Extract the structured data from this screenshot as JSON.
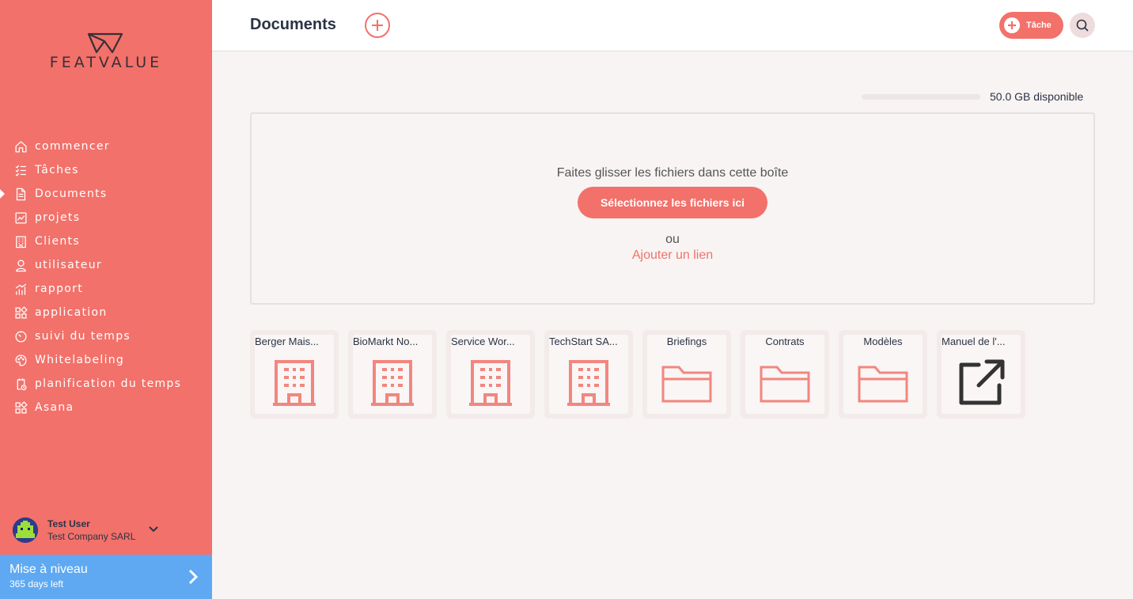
{
  "brand": {
    "logo_text": "FEATVALUE"
  },
  "sidebar": {
    "items": [
      {
        "label": "commencer",
        "icon": "home-icon"
      },
      {
        "label": "Tâches",
        "icon": "checklist-icon"
      },
      {
        "label": "Documents",
        "icon": "document-icon",
        "active": true
      },
      {
        "label": "projets",
        "icon": "chart-icon"
      },
      {
        "label": "Clients",
        "icon": "building-icon"
      },
      {
        "label": "utilisateur",
        "icon": "user-icon"
      },
      {
        "label": "rapport",
        "icon": "report-icon"
      },
      {
        "label": "application",
        "icon": "apps-icon"
      },
      {
        "label": "suivi du temps",
        "icon": "timer-icon"
      },
      {
        "label": "Whitelabeling",
        "icon": "palette-icon"
      },
      {
        "label": "planification du temps",
        "icon": "schedule-icon"
      },
      {
        "label": "Asana",
        "icon": "apps-icon"
      }
    ]
  },
  "user": {
    "name": "Test User",
    "company": "Test Company SARL"
  },
  "upgrade": {
    "title": "Mise à niveau",
    "subtitle": "365 days left"
  },
  "header": {
    "title": "Documents",
    "task_label": "Tâche"
  },
  "storage": {
    "text": "50.0 GB disponible",
    "used_fraction": 0
  },
  "dropzone": {
    "instruction": "Faites glisser les fichiers dans cette boîte",
    "select_label": "Sélectionnez les fichiers ici",
    "or_label": "ou",
    "link_label": "Ajouter un lien"
  },
  "tiles": [
    {
      "name": "Berger Mais...",
      "type": "client",
      "icon": "building-icon"
    },
    {
      "name": "BioMarkt No...",
      "type": "client",
      "icon": "building-icon"
    },
    {
      "name": "Service Wor...",
      "type": "client",
      "icon": "building-icon"
    },
    {
      "name": "TechStart SA...",
      "type": "client",
      "icon": "building-icon"
    },
    {
      "name": "Briefings",
      "type": "folder",
      "icon": "folder-icon"
    },
    {
      "name": "Contrats",
      "type": "folder",
      "icon": "folder-icon"
    },
    {
      "name": "Modèles",
      "type": "folder",
      "icon": "folder-icon"
    },
    {
      "name": "Manuel de l'...",
      "type": "link",
      "icon": "external-link-icon"
    }
  ],
  "colors": {
    "accent": "#f2716a",
    "upgrade": "#5ea9f2",
    "text": "#2c3345"
  }
}
